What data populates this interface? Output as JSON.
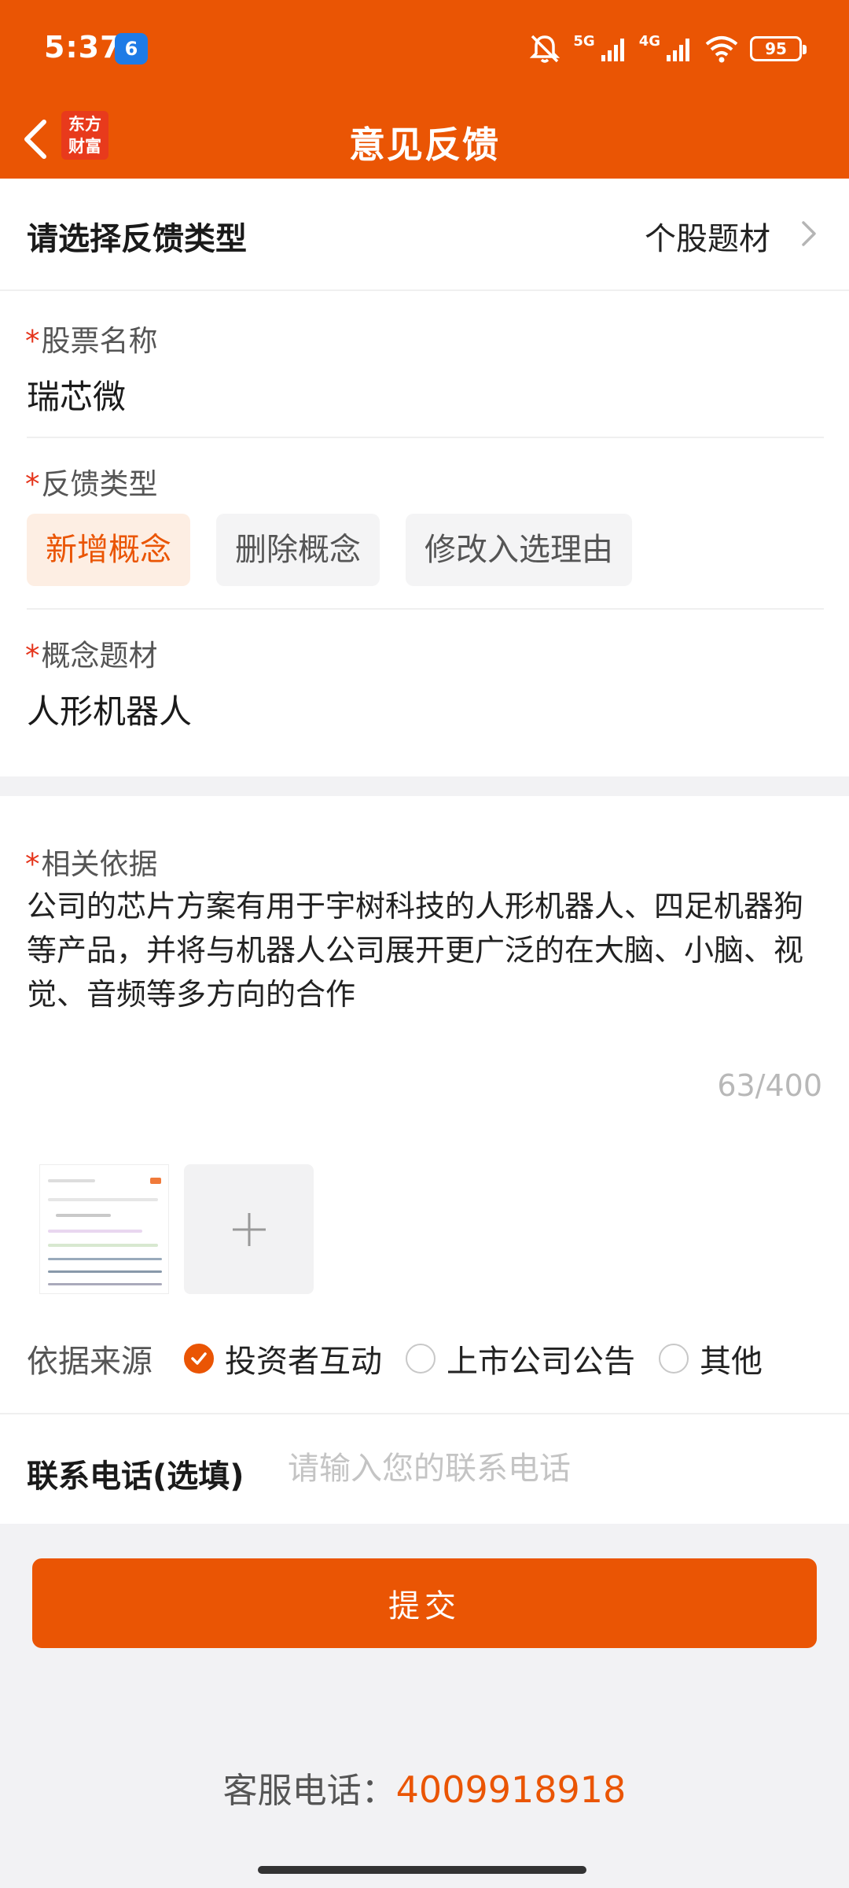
{
  "status_bar": {
    "time": "5:37",
    "app_notification_icon": "6",
    "network_1": "5G",
    "network_2": "4G",
    "battery": "95"
  },
  "header": {
    "back_icon": "chevron-left-icon",
    "logo_text": "东方财富",
    "title": "意见反馈"
  },
  "feedback_type_row": {
    "label": "请选择反馈类型",
    "value": "个股题材"
  },
  "form": {
    "stock_name": {
      "required_mark": "*",
      "label": "股票名称",
      "value": "瑞芯微"
    },
    "feedback_kind": {
      "required_mark": "*",
      "label": "反馈类型",
      "options": [
        "新增概念",
        "删除概念",
        "修改入选理由"
      ],
      "selected": "新增概念"
    },
    "concept": {
      "required_mark": "*",
      "label": "概念题材",
      "value": "人形机器人"
    },
    "basis": {
      "required_mark": "*",
      "label": "相关依据",
      "text": "公司的芯片方案有用于宇树科技的人形机器人、四足机器狗等产品，并将与机器人公司展开更广泛的在大脑、小脑、视觉、音频等多方向的合作",
      "counter": "63/400"
    },
    "source": {
      "label": "依据来源",
      "options": [
        "投资者互动",
        "上市公司公告",
        "其他"
      ],
      "selected": "投资者互动"
    },
    "phone": {
      "label": "联系电话(选填)",
      "placeholder": "请输入您的联系电话",
      "value": ""
    }
  },
  "submit_label": "提交",
  "service": {
    "label": "客服电话：",
    "number": "4009918918"
  },
  "colors": {
    "brand": "#ea5504",
    "required": "#e5351c",
    "chip_active_bg": "#fdeee3"
  }
}
